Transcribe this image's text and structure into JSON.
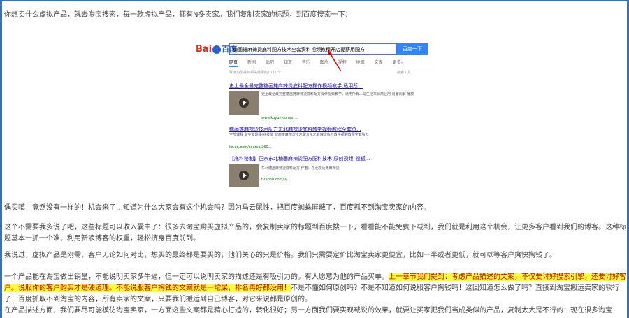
{
  "paragraphs": {
    "p1": "你想卖什么虚拟产品，就去淘宝搜索，每一款虚拟产品，都有N多卖家。我们复制卖家的标题，到百度搜索一下：",
    "p2": "偶买噶！竟然没有一样的！机会来了…知道为什么大家会有这个机会吗？因为马云尿性，把百度蜘蛛屏蔽了，百度抓不到淘宝卖家的内容。",
    "p3": "这个不需要我多说了吧，这些标题可以收入囊中了：很多去淘宝购买虚拟产品的，会复制卖家的标题到百度搜一下，看看能不能免费下载到，我们就是利用这个机会，让更多客户看到我们的博客。这种标题基本一抓一个准，利用新浪博客的权重，轻松挤身百度前列。",
    "p4": "我说过，虚拟产品是刚需，客户无论如何对比，想买的最终都是要买的，他们关心的只是价格。我们只需要定价比淘宝卖家更便宜，比如一半或者更低，就可以等客户爽快掏钱了。",
    "p5_a": "一个产品能在淘宝做出销量，不能说明卖家多牛逼，但一定可以说明卖家的描述还是有吸引力的。有人愿意为他的产品买单。",
    "p5_hl": "上一章节我们提到：考虑产品描述的文案，不仅要讨好搜索引擎，还要讨好客户。说服你的客户购买才是硬道理。不能说服客户掏钱的文案就是一坨屎，排名再好都没用！",
    "p5_b": "不是不懂如何原创吗？不是不知道如何说服客户掏钱吗！这回知道怎么做了吗？直接到淘宝搬运卖家的软行了！百度抓取不到淘宝的内容，所有卖家的文案，只要我们搬运到自己博客，对它来说都是原创的。",
    "p6": "在产品描述方面，我们要尽可能模仿淘宝卖家，一方面这些文案都是精心打造的，转化很好；另一方面我们要实现载说的效果，就要让买家把我们当成类似的产品，复制太大是不行的：现在很多淘宝"
  },
  "screenshot": {
    "logo_text": "Bai",
    "logo_text2": "百度",
    "query": "糖画摊麻辣烫底料配方技术全套资料视频教程开店提薪用配方",
    "search_button": "百度一下",
    "tabs": [
      "网页",
      "新闻",
      "贴吧",
      "知道",
      "音乐",
      "图片",
      "视频",
      "地图",
      "文库",
      "更多»"
    ],
    "meta_left": "百度为您找到相关结果约1,000个",
    "meta_right": "搜索工具",
    "result1_title": "史上最全最完整糖画摊麻辣烫底料配方操作视频教学,适用所...",
    "result1_text": "史上最全最完整糖画摊麻辣烫底料配方操作视频教学，适用所有人是生活来源商业用 易面调解 播放",
    "result1_url": "www.kuyun.com/v_...",
    "result2_title": "糖画摊麻辣烫技术配方东北麻辣烫底料教学视频教程全套资...",
    "result2_text": "全部课程 职业专题 职业技能 糖画摊麻辣烫技术配方东北麻辣烫底料教学视频教程全套资料",
    "result2_url": "ke.qq.com/course/260...",
    "result3_title": "【底料秘制】正宗东北糖画麻辣烫配方配料技术 原创视频_搜狐...",
    "result3_text": "东北糖画麻辣烫底料配方 作者：东北慢活摊麻辣烫",
    "result3_url": "tv.sohu.com/v/..."
  }
}
